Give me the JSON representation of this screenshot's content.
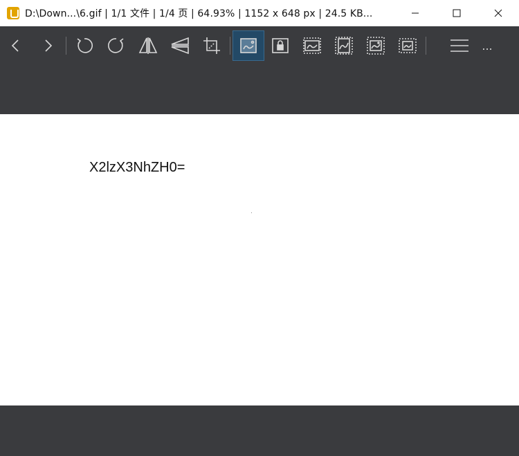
{
  "window": {
    "title": "D:\\Down...\\6.gif  |  1/1 文件  |  1/4 页  |  64.93%  |  1152 x 648 px  |  24.5 KB...",
    "controls": [
      "minimize-icon",
      "maximize-icon",
      "close-icon"
    ]
  },
  "toolbar": {
    "icons": [
      "back-icon",
      "forward-icon",
      "rotate-left-icon",
      "rotate-right-icon",
      "flip-horizontal-icon",
      "flip-vertical-icon",
      "crop-icon",
      "fit-window-icon",
      "lock-zoom-icon",
      "fit-width-icon",
      "fit-height-icon",
      "auto-fit-icon",
      "original-size-icon",
      "menu-icon",
      "more-icon"
    ],
    "more_label": "..."
  },
  "image": {
    "text": "X2lzX3NhZH0="
  },
  "colors": {
    "chrome": "#3a3b3e",
    "active": "#234966",
    "canvas": "#ffffff"
  }
}
